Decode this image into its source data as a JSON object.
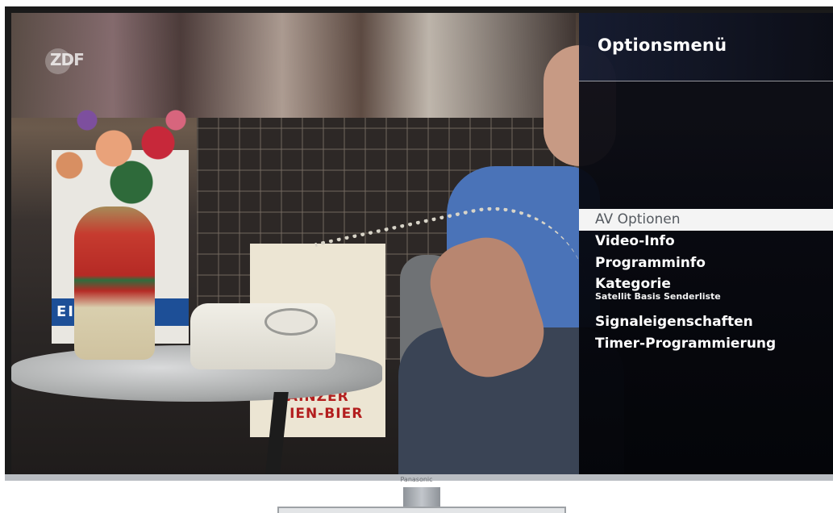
{
  "channel_logo": "ZDF",
  "tv_brand": "Panasonic",
  "options_menu": {
    "title": "Optionsmenü",
    "items": [
      {
        "label": "AV Optionen",
        "selected": true
      },
      {
        "label": "Video-Info"
      },
      {
        "label": "Programminfo"
      },
      {
        "label": "Kategorie",
        "sublabel": "Satellit Basis Senderliste"
      },
      {
        "label": "Signaleigenschaften"
      },
      {
        "label": "Timer-Programmierung"
      }
    ]
  },
  "scene_text": {
    "poster_left": "EI      IER",
    "poster_mid_line1": "MAINZER",
    "poster_mid_line2": "A  IEN-BIER"
  },
  "colors": {
    "menu_background": "#05070f",
    "selected_item_background": "#f4f4f4",
    "selected_item_text": "#555a60",
    "menu_text": "#ffffff"
  }
}
